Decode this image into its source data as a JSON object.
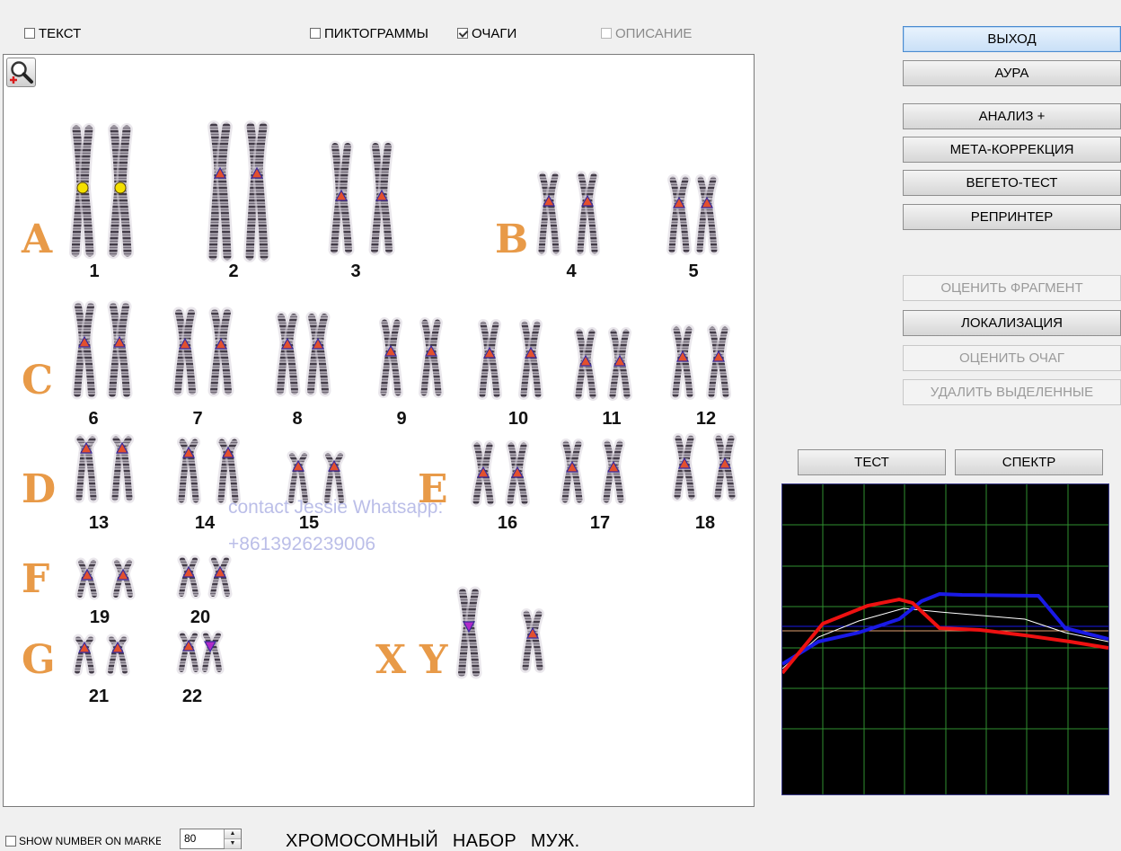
{
  "toolbar": {
    "text_label": "ТЕКСТ",
    "text_checked": false,
    "pictograms_label": "ПИКТОГРАММЫ",
    "pictograms_checked": false,
    "foci_label": "ОЧАГИ",
    "foci_checked": true,
    "description_label": "ОПИСАНИЕ",
    "description_enabled": false
  },
  "karyotype": {
    "zoom_icon": "zoom-in-icon",
    "groups": [
      "A",
      "B",
      "C",
      "D",
      "E",
      "F",
      "G",
      "X",
      "Y"
    ],
    "chromosome_numbers": [
      "1",
      "2",
      "3",
      "4",
      "5",
      "6",
      "7",
      "8",
      "9",
      "10",
      "11",
      "12",
      "13",
      "14",
      "15",
      "16",
      "17",
      "18",
      "19",
      "20",
      "21",
      "22"
    ],
    "watermark_line1": "contact Jessie Whatsapp:",
    "watermark_line2": "+8613926239006",
    "marker_colors": {
      "triangle": "#e2502e",
      "triangle_outline": "#3a2a9a",
      "circle": "#f4e000",
      "sex_marker": "#b02ac8"
    }
  },
  "buttons": {
    "exit": "ВЫХОД",
    "aura": "АУРА",
    "analysis": "АНАЛИЗ +",
    "meta_correction": "МЕТА-КОРРЕКЦИЯ",
    "vegeto_test": "ВЕГЕТО-ТЕСТ",
    "reprinter": "РЕПРИНТЕР",
    "evaluate_fragment": "ОЦЕНИТЬ ФРАГМЕНТ",
    "localization": "ЛОКАЛИЗАЦИЯ",
    "evaluate_focus": "ОЦЕНИТЬ ОЧАГ",
    "delete_selected": "УДАЛИТЬ ВЫДЕЛЕННЫЕ",
    "test": "ТЕСТ",
    "spectrum": "СПЕКТР"
  },
  "spectrum_graph": {
    "grid_color": "#2f8f2f",
    "series_colors": {
      "red": "#ee1111",
      "blue": "#1a1ae6",
      "white": "#ffffff",
      "orange": "#e0a070"
    }
  },
  "bottom": {
    "show_number_label": "SHOW NUMBER ON MARKER",
    "show_number_checked": false,
    "spin_value": "80",
    "status_text": "ХРОМОСОМНЫЙ НАБОР МУЖ."
  }
}
